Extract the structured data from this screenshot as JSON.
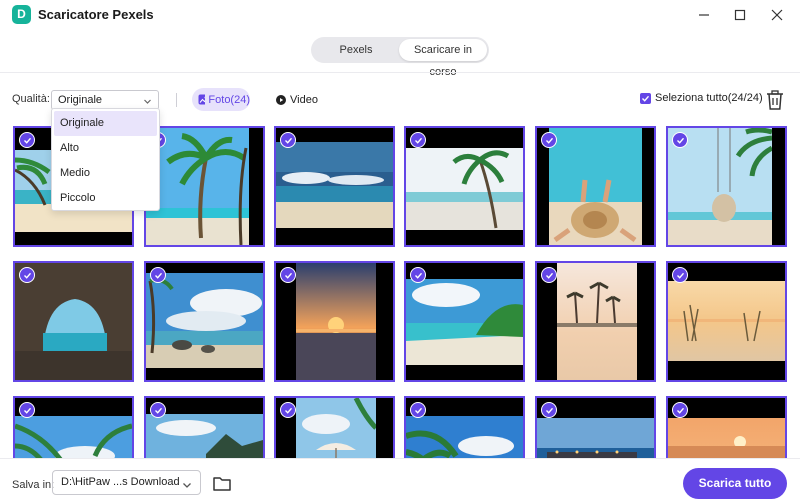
{
  "app": {
    "logo_letter": "D",
    "title": "Scaricatore Pexels"
  },
  "tabs": [
    {
      "label": "Pexels",
      "active": false
    },
    {
      "label": "Scaricare in corso",
      "active": true
    }
  ],
  "toolbar": {
    "quality_label": "Qualità:",
    "quality_value": "Originale",
    "quality_options": [
      "Originale",
      "Alto",
      "Medio",
      "Piccolo"
    ],
    "photo_filter": "Foto(24)",
    "video_filter": "Video",
    "select_all": "Seleziona tutto(24/24)",
    "select_all_checked": true
  },
  "images": [
    {
      "scene": "beach-palms-left",
      "selected": true
    },
    {
      "scene": "palm-tree-sky",
      "selected": true
    },
    {
      "scene": "ocean-horizon",
      "selected": true
    },
    {
      "scene": "palms-windy-beach",
      "selected": true
    },
    {
      "scene": "woman-hat-beach",
      "selected": true
    },
    {
      "scene": "swing-palm",
      "selected": true
    },
    {
      "scene": "sea-cave",
      "selected": true
    },
    {
      "scene": "rocky-coast-clouds",
      "selected": true
    },
    {
      "scene": "sunset-sea",
      "selected": true
    },
    {
      "scene": "tropical-island-shore",
      "selected": true
    },
    {
      "scene": "desert-palms-sunset",
      "selected": true
    },
    {
      "scene": "dune-grass-sunset",
      "selected": true
    },
    {
      "scene": "palm-fronds-sky",
      "selected": true
    },
    {
      "scene": "mountain-bay",
      "selected": true
    },
    {
      "scene": "umbrella-beach",
      "selected": true
    },
    {
      "scene": "palm-ocean-clouds",
      "selected": true
    },
    {
      "scene": "resort-pier-dusk",
      "selected": true
    },
    {
      "scene": "orange-sunset",
      "selected": true
    }
  ],
  "footer": {
    "save_label": "Salva in:",
    "save_path": "D:\\HitPaw ...s Download",
    "download_button": "Scarica tutto"
  },
  "colors": {
    "accent": "#6346e6",
    "logo": "#16b39a"
  }
}
